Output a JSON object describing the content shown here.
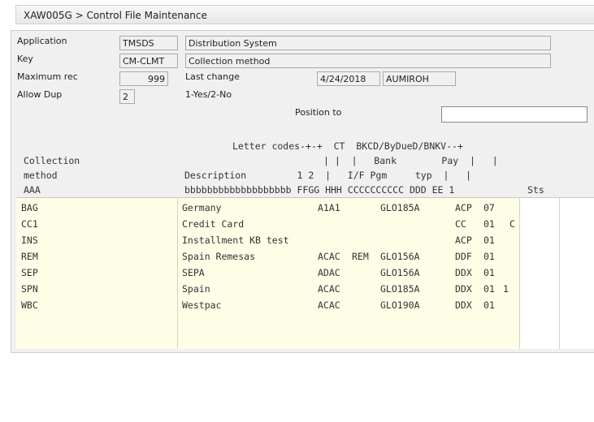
{
  "window": {
    "title": "XAW005G > Control File Maintenance"
  },
  "form": {
    "application": {
      "label": "Application",
      "code": "TMSDS",
      "description": "Distribution System"
    },
    "key": {
      "label": "Key",
      "code": "CM-CLMT",
      "description": "Collection method"
    },
    "max_rec": {
      "label": "Maximum rec",
      "value": "999"
    },
    "last_change": {
      "label": "Last change",
      "date": "4/24/2018",
      "user": "AUMIROH"
    },
    "allow_dup": {
      "label": "Allow Dup",
      "value": "2",
      "hint": "1-Yes/2-No"
    },
    "position_to": {
      "label": "Position to",
      "value": ""
    }
  },
  "headers": {
    "line1": "Letter codes-+-+  CT  BKCD/ByDueD/BNKV--+",
    "line2a": "Collection",
    "line2b": "| |  |   Bank        Pay  |   |",
    "line3a": "method",
    "line3b": "Description         1 2  |   I/F Pgm     typ  |   |",
    "line4a": "AAA",
    "line4b": "bbbbbbbbbbbbbbbbbbb FFGG HHH CCCCCCCCCC DDD EE 1",
    "sts": "Sts"
  },
  "rows": [
    {
      "method": "BAG",
      "desc": "Germany",
      "letters": "A1A1",
      "ct": "",
      "bank": "GLO185A",
      "pay": "ACP",
      "ee": "07",
      "f1": "",
      "f2": ""
    },
    {
      "method": "CC1",
      "desc": "Credit Card",
      "letters": "",
      "ct": "",
      "bank": "",
      "pay": "CC",
      "ee": "01",
      "f1": "",
      "f2": "C"
    },
    {
      "method": "INS",
      "desc": "Installment KB test",
      "letters": "",
      "ct": "",
      "bank": "",
      "pay": "ACP",
      "ee": "01",
      "f1": "",
      "f2": ""
    },
    {
      "method": "REM",
      "desc": "Spain Remesas",
      "letters": "ACAC",
      "ct": "REM",
      "bank": "GLO156A",
      "pay": "DDF",
      "ee": "01",
      "f1": "",
      "f2": ""
    },
    {
      "method": "SEP",
      "desc": "SEPA",
      "letters": "ADAC",
      "ct": "",
      "bank": "GLO156A",
      "pay": "DDX",
      "ee": "01",
      "f1": "",
      "f2": ""
    },
    {
      "method": "SPN",
      "desc": "Spain",
      "letters": "ACAC",
      "ct": "",
      "bank": "GLO185A",
      "pay": "DDX",
      "ee": "01",
      "f1": "1",
      "f2": ""
    },
    {
      "method": "WBC",
      "desc": "Westpac",
      "letters": "ACAC",
      "ct": "",
      "bank": "GLO190A",
      "pay": "DDX",
      "ee": "01",
      "f1": "",
      "f2": ""
    }
  ]
}
